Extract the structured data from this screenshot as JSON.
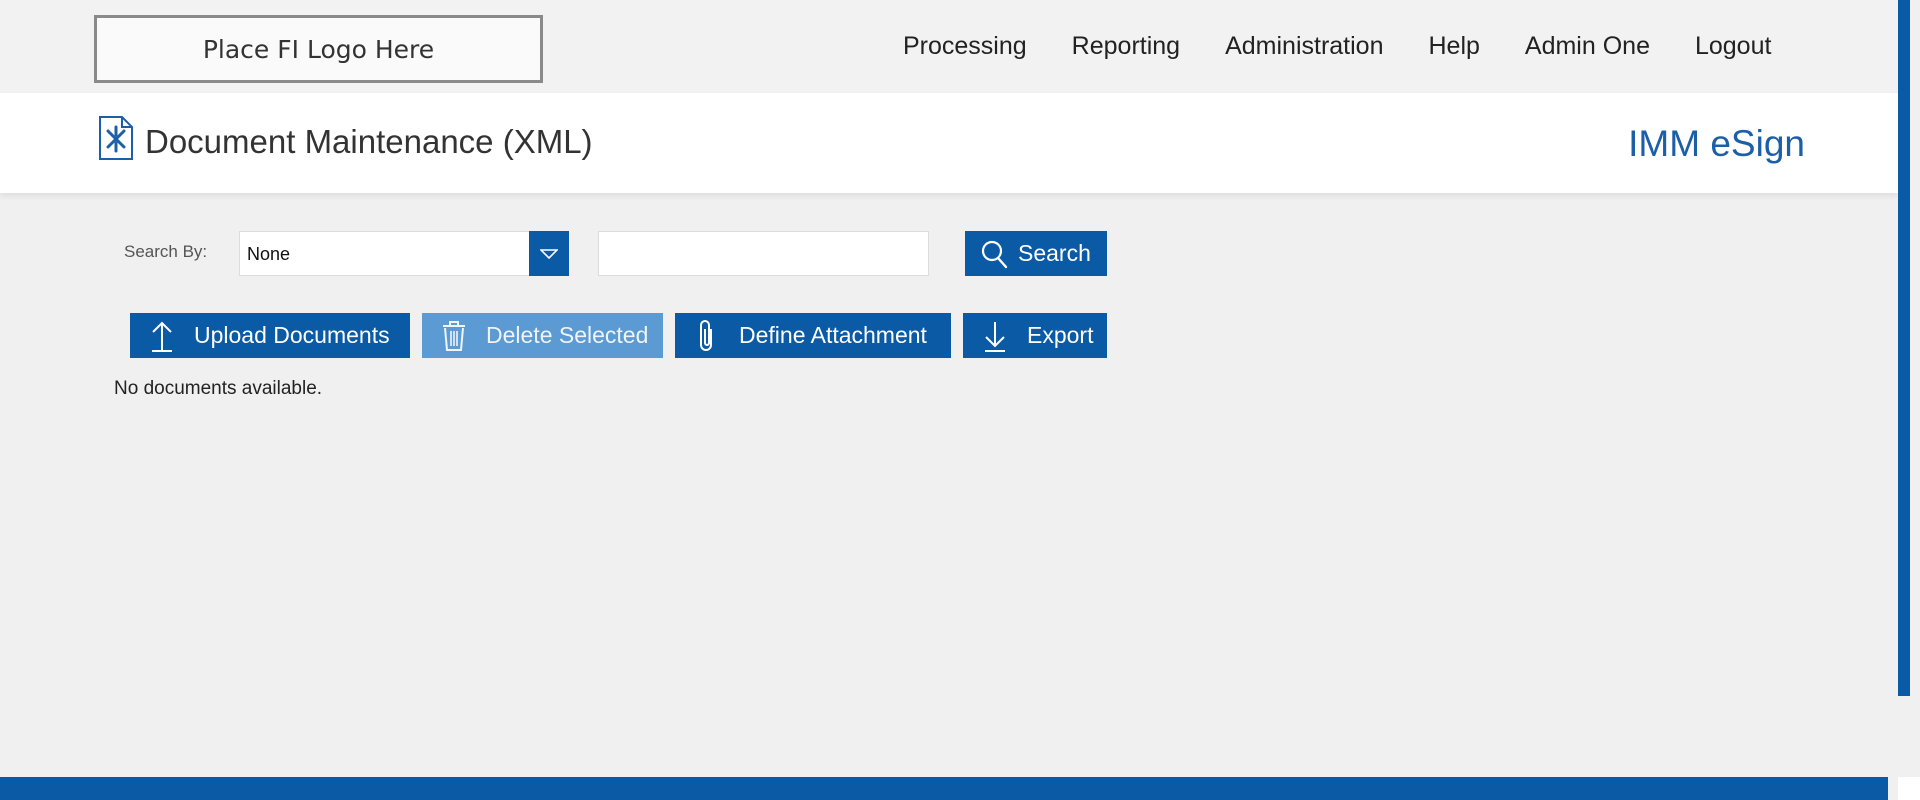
{
  "header": {
    "logo_text": "Place FI Logo Here",
    "nav": [
      "Processing",
      "Reporting",
      "Administration",
      "Help",
      "Admin One",
      "Logout"
    ]
  },
  "title_band": {
    "page_title": "Document Maintenance (XML)",
    "brand": "IMM eSign"
  },
  "search": {
    "label": "Search By:",
    "select_value": "None",
    "input_value": "",
    "button_label": "Search"
  },
  "actions": {
    "upload": "Upload Documents",
    "delete": "Delete Selected",
    "define": "Define Attachment",
    "export": "Export"
  },
  "status": {
    "empty_message": "No documents available."
  },
  "colors": {
    "primary": "#0a5aa6",
    "primary_disabled": "#5b9ad2",
    "brand_text": "#1b5fa8",
    "page_bg": "#f0f0f0"
  },
  "icons": {
    "page": "document-tools-icon",
    "search": "magnifier-icon",
    "upload": "arrow-up-icon",
    "delete": "trash-icon",
    "attach": "paperclip-icon",
    "export": "arrow-down-icon",
    "dropdown": "chevron-down-icon"
  }
}
